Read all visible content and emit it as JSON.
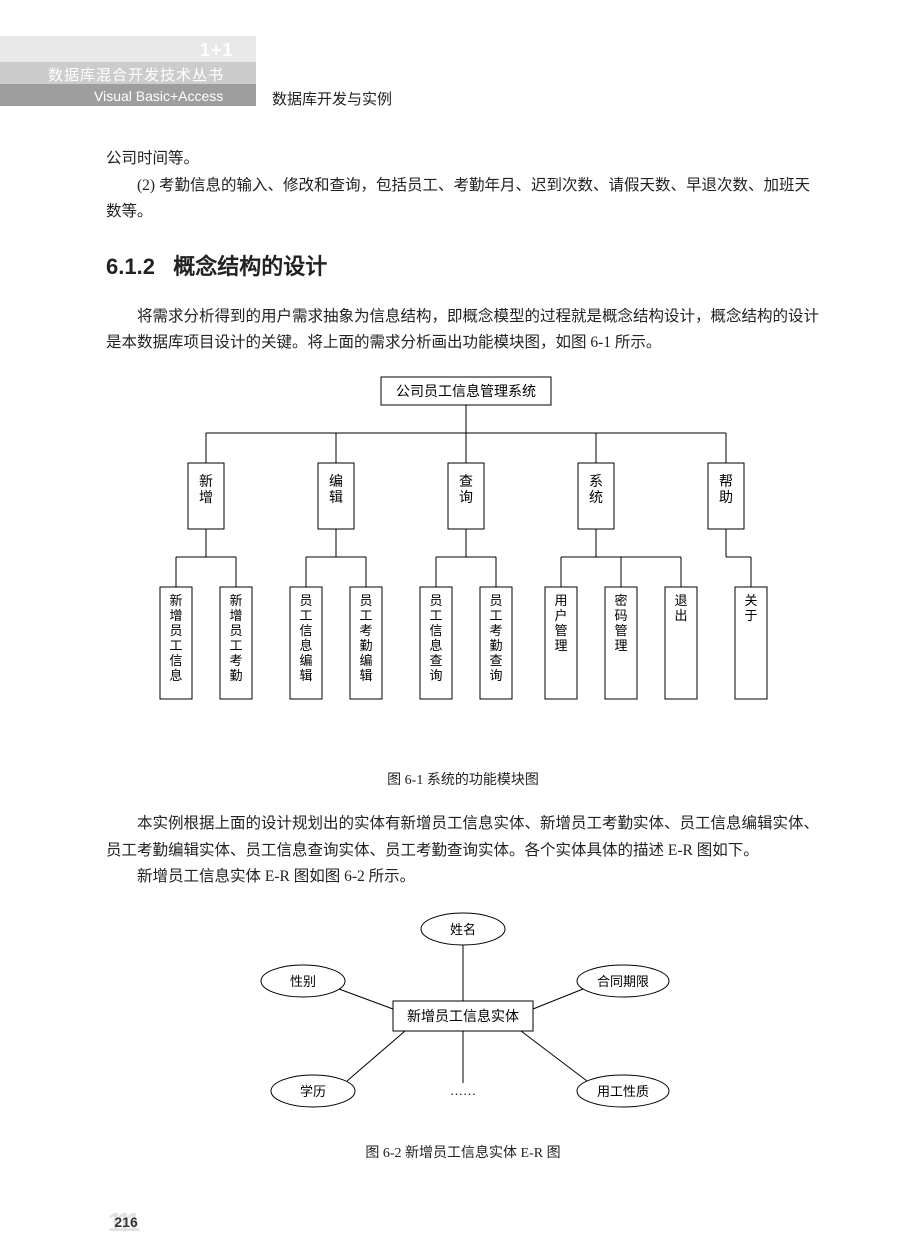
{
  "header": {
    "tag": "1+1",
    "series": "数据库混合开发技术丛书",
    "tech": "Visual  Basic+Access",
    "title": "数据库开发与实例"
  },
  "top_paras": {
    "p1": "公司时间等。",
    "p2": "(2) 考勤信息的输入、修改和查询，包括员工、考勤年月、迟到次数、请假天数、早退次数、加班天数等。"
  },
  "section": {
    "num": "6.1.2",
    "title": "概念结构的设计"
  },
  "para_intro": "将需求分析得到的用户需求抽象为信息结构，即概念模型的过程就是概念结构设计，概念结构的设计是本数据库项目设计的关键。将上面的需求分析画出功能模块图，如图 6-1 所示。",
  "fig61": {
    "root": "公司员工信息管理系统",
    "level2": [
      "新增",
      "编辑",
      "查询",
      "系统",
      "帮助"
    ],
    "level3": [
      "新增员工信息",
      "新增员工考勤",
      "员工信息编辑",
      "员工考勤编辑",
      "员工信息查询",
      "员工考勤查询",
      "用户管理",
      "密码管理",
      "退出",
      "关于"
    ],
    "caption": "图 6-1    系统的功能模块图"
  },
  "para_after_fig61": {
    "p1": "本实例根据上面的设计规划出的实体有新增员工信息实体、新增员工考勤实体、员工信息编辑实体、员工考勤编辑实体、员工信息查询实体、员工考勤查询实体。各个实体具体的描述 E-R 图如下。",
    "p2": "新增员工信息实体 E-R 图如图 6-2 所示。"
  },
  "fig62": {
    "center": "新增员工信息实体",
    "attrs": [
      "姓名",
      "性别",
      "合同期限",
      "学历",
      "用工性质"
    ],
    "ellipsis": "……",
    "caption": "图 6-2    新增员工信息实体 E-R 图"
  },
  "page_number": "216"
}
